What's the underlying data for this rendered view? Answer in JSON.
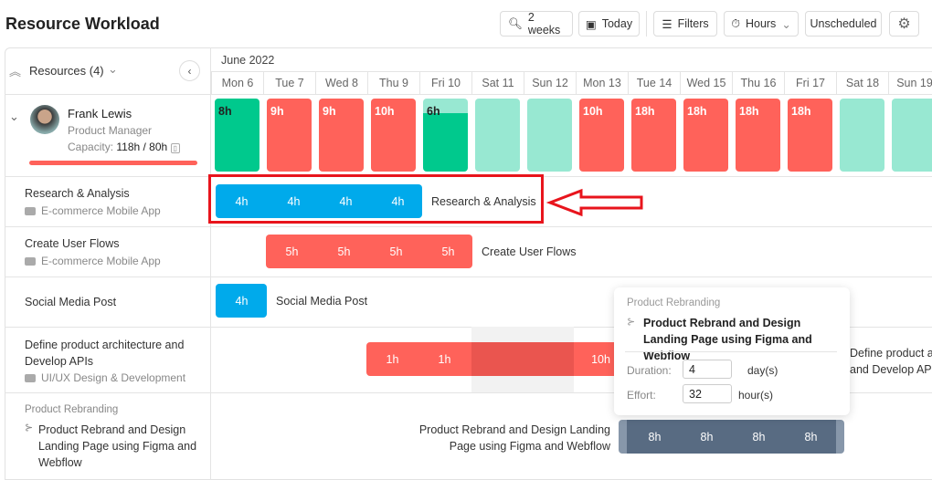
{
  "header": {
    "title": "Resource Workload",
    "buttons": {
      "zoom": "2 weeks",
      "today": "Today",
      "filters": "Filters",
      "hours": "Hours",
      "unscheduled": "Unscheduled"
    }
  },
  "panel": {
    "resources_label": "Resources (4)"
  },
  "calendar": {
    "month": "June 2022",
    "days": [
      "Mon 6",
      "Tue 7",
      "Wed 8",
      "Thu 9",
      "Fri 10",
      "Sat 11",
      "Sun 12",
      "Mon 13",
      "Tue 14",
      "Wed 15",
      "Thu 16",
      "Fri 17",
      "Sat 18",
      "Sun 19"
    ]
  },
  "resource": {
    "name": "Frank Lewis",
    "role": "Product Manager",
    "capacity_label": "Capacity:",
    "capacity_value": "118h / 80h",
    "workload": [
      {
        "label": "8h",
        "status": "ok"
      },
      {
        "label": "9h",
        "status": "over"
      },
      {
        "label": "9h",
        "status": "over"
      },
      {
        "label": "10h",
        "status": "over"
      },
      {
        "label": "6h",
        "status": "partial",
        "fill": 0.8
      },
      {
        "label": "",
        "status": "free"
      },
      {
        "label": "",
        "status": "free"
      },
      {
        "label": "10h",
        "status": "over"
      },
      {
        "label": "18h",
        "status": "over"
      },
      {
        "label": "18h",
        "status": "over"
      },
      {
        "label": "18h",
        "status": "over"
      },
      {
        "label": "18h",
        "status": "over"
      },
      {
        "label": "",
        "status": "free"
      },
      {
        "label": "",
        "status": "free"
      }
    ]
  },
  "colors": {
    "ok": "#00c98d",
    "over": "#ff625a",
    "free": "#98e8d2",
    "blue": "#00aaeb",
    "slate": "#586b82",
    "highlight": "#e8141c"
  },
  "tasks": [
    {
      "name": "Research & Analysis",
      "project": "E-commerce Mobile App",
      "hours": [
        "4h",
        "4h",
        "4h",
        "4h"
      ],
      "bar_label": "Research & Analysis"
    },
    {
      "name": "Create User Flows",
      "project": "E-commerce Mobile App",
      "hours": [
        "5h",
        "5h",
        "5h",
        "5h"
      ],
      "bar_label": "Create User Flows"
    },
    {
      "name": "Social Media Post",
      "hours": [
        "4h"
      ],
      "bar_label": "Social Media Post"
    },
    {
      "name": "Define product architecture and Develop APIs",
      "project": "UI/UX Design & Development",
      "hours": [
        "1h",
        "1h",
        "10h"
      ],
      "bar_label_1": "Define product ar",
      "bar_label_2": "and Develop API"
    },
    {
      "parent": "Product Rebranding",
      "name": "Product Rebrand and Design Landing Page using Figma and Webflow",
      "hours": [
        "8h",
        "8h",
        "8h",
        "8h"
      ],
      "bar_label_1": "Product Rebrand and Design Landing",
      "bar_label_2": "Page using Figma and Webflow"
    }
  ],
  "tooltip": {
    "parent": "Product Rebranding",
    "title": "Product Rebrand and Design Landing Page using Figma and Webflow",
    "duration_label": "Duration:",
    "duration_value": "4",
    "duration_unit": "day(s)",
    "effort_label": "Effort:",
    "effort_value": "32",
    "effort_unit": "hour(s)"
  }
}
